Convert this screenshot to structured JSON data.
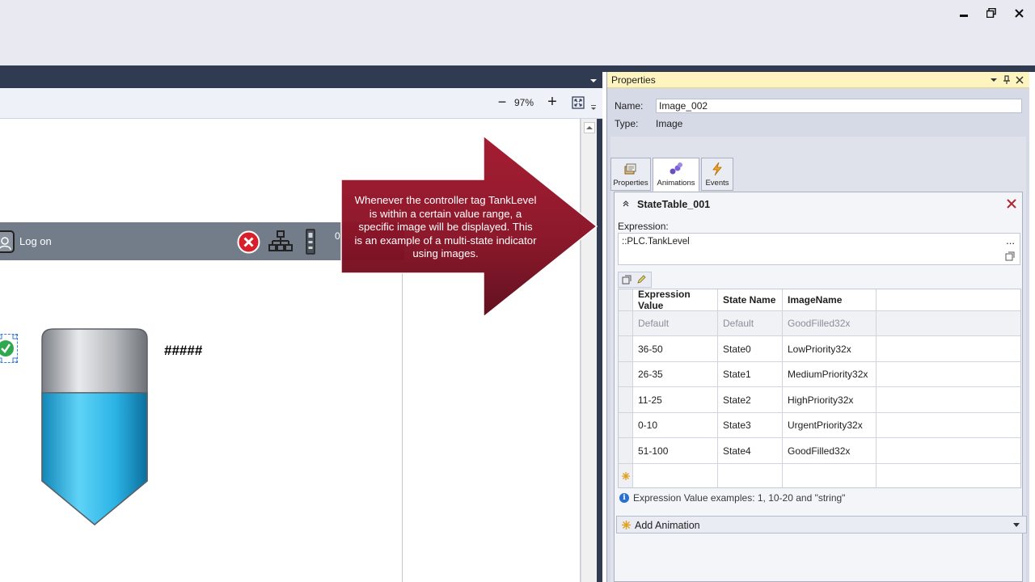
{
  "window": {
    "controls": [
      "minimize-icon",
      "restore-icon",
      "close-icon"
    ]
  },
  "zoom": {
    "minus_label": "−",
    "value": "97%",
    "plus_label": "+"
  },
  "hmi": {
    "logon_label": "Log on",
    "clock_text": "0",
    "tag_display": "#####",
    "tank_level_fraction": 0.62,
    "colors": {
      "header": "#737d89",
      "tank_fill": "#31b6e7",
      "status_ok": "#2fa84f",
      "error_red": "#d8202a"
    }
  },
  "callout": {
    "text": "Whenever the controller tag TankLevel is within a certain value range, a specific image will be displayed.  This is an example of a multi-state indicator using images.",
    "color": "#8a1226"
  },
  "properties": {
    "title": "Properties",
    "name_label": "Name:",
    "name_value": "Image_002",
    "type_label": "Type:",
    "type_value": "Image",
    "tabs": [
      {
        "label": "Properties",
        "icon": "properties-icon"
      },
      {
        "label": "Animations",
        "icon": "animations-icon"
      },
      {
        "label": "Events",
        "icon": "events-icon"
      }
    ],
    "active_tab": "Animations",
    "state_table": {
      "title": "StateTable_001",
      "expression_label": "Expression:",
      "expression_value": "::PLC.TankLevel",
      "browse_label": "...",
      "columns": [
        "Expression Value",
        "State Name",
        "ImageName"
      ],
      "default_row": [
        "Default",
        "Default",
        "GoodFilled32x"
      ],
      "rows": [
        [
          "36-50",
          "State0",
          "LowPriority32x"
        ],
        [
          "26-35",
          "State1",
          "MediumPriority32x"
        ],
        [
          "11-25",
          "State2",
          "HighPriority32x"
        ],
        [
          "0-10",
          "State3",
          "UrgentPriority32x"
        ],
        [
          "51-100",
          "State4",
          "GoodFilled32x"
        ]
      ],
      "hint": "Expression Value examples: 1, 10-20 and \"string\""
    },
    "add_animation_label": "Add Animation"
  }
}
